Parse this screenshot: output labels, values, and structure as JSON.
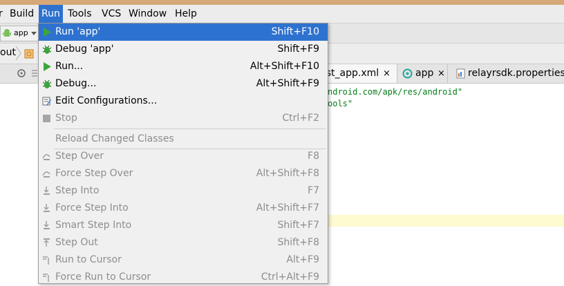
{
  "menubar": {
    "items": [
      {
        "label": "Build"
      },
      {
        "label": "Run"
      },
      {
        "label": "Tools"
      },
      {
        "label": "VCS"
      },
      {
        "label": "Window"
      },
      {
        "label": "Help"
      }
    ]
  },
  "toolbar": {
    "config_combo": "app"
  },
  "navbar": {
    "crumb": "out"
  },
  "tabs": [
    {
      "label": "rst_app.xml",
      "close": "×"
    },
    {
      "label": "app",
      "close": "×"
    },
    {
      "label": "relayrsdk.properties"
    }
  ],
  "editor": {
    "lines": [
      "ndroid.com/apk/res/android\"",
      "ools\""
    ]
  },
  "run_menu": {
    "items": [
      {
        "label": "Run 'app'",
        "shortcut": "Shift+F10"
      },
      {
        "label": "Debug 'app'",
        "shortcut": "Shift+F9"
      },
      {
        "label": "Run...",
        "shortcut": "Alt+Shift+F10"
      },
      {
        "label": "Debug...",
        "shortcut": "Alt+Shift+F9"
      },
      {
        "label": "Edit Configurations...",
        "shortcut": ""
      },
      {
        "label": "Stop",
        "shortcut": "Ctrl+F2"
      },
      {
        "label": "Reload Changed Classes",
        "shortcut": ""
      },
      {
        "label": "Step Over",
        "shortcut": "F8"
      },
      {
        "label": "Force Step Over",
        "shortcut": "Alt+Shift+F8"
      },
      {
        "label": "Step Into",
        "shortcut": "F7"
      },
      {
        "label": "Force Step Into",
        "shortcut": "Alt+Shift+F7"
      },
      {
        "label": "Smart Step Into",
        "shortcut": "Shift+F7"
      },
      {
        "label": "Step Out",
        "shortcut": "Shift+F8"
      },
      {
        "label": "Run to Cursor",
        "shortcut": "Alt+F9"
      },
      {
        "label": "Force Run to Cursor",
        "shortcut": "Ctrl+Alt+F9"
      }
    ]
  },
  "colors": {
    "selection": "#2e72cf",
    "run_green": "#3ba63b",
    "disabled_text": "#8d8d8d"
  }
}
